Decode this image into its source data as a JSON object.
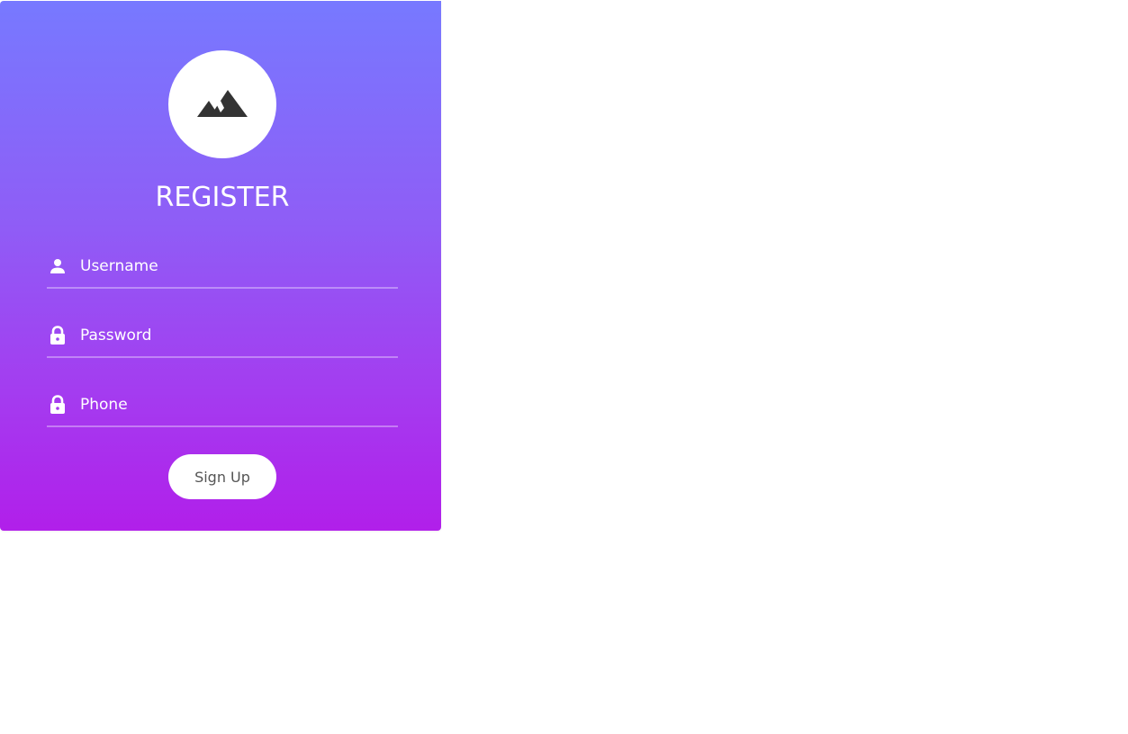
{
  "form": {
    "logo_icon": "mountain-icon",
    "title": "REGISTER",
    "fields": [
      {
        "icon": "user-icon",
        "placeholder": "Username"
      },
      {
        "icon": "lock-icon",
        "placeholder": "Password"
      },
      {
        "icon": "lock-icon",
        "placeholder": "Phone"
      }
    ],
    "submit_label": "Sign Up"
  },
  "colors": {
    "gradient_top": "#7779ff",
    "gradient_bottom": "#b11fea",
    "logo_glyph": "#333333",
    "button_text": "#555555"
  }
}
